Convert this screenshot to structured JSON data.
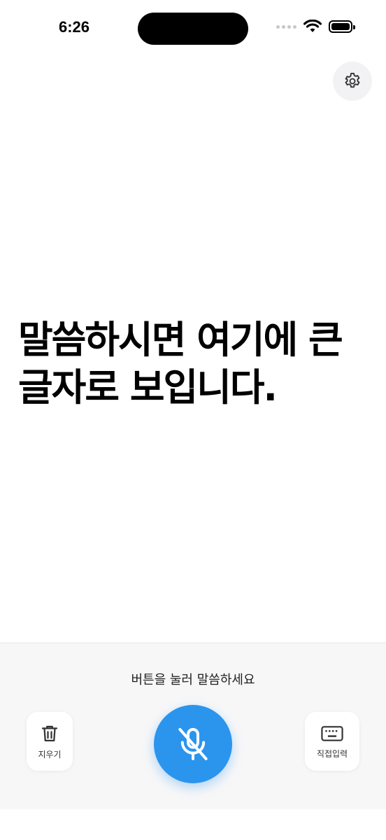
{
  "status_bar": {
    "time": "6:26",
    "icons": [
      "cellular-signal-icon",
      "wifi-icon",
      "battery-icon"
    ]
  },
  "header": {
    "settings_icon": "gear-icon"
  },
  "main": {
    "caption_line1": "말씀하시면 여기에 큰",
    "caption_line2": "글자로 보입니다."
  },
  "bottom": {
    "hint": "버튼을 눌러 말씀하세요",
    "clear_label": "지우기",
    "clear_icon": "trash-icon",
    "keyboard_label": "직접입력",
    "keyboard_icon": "keyboard-icon",
    "mic_icon": "mic-off-icon"
  },
  "colors": {
    "accent": "#2b95ee",
    "panel_bg": "#f7f7f8",
    "settings_bg": "#f2f2f4"
  }
}
